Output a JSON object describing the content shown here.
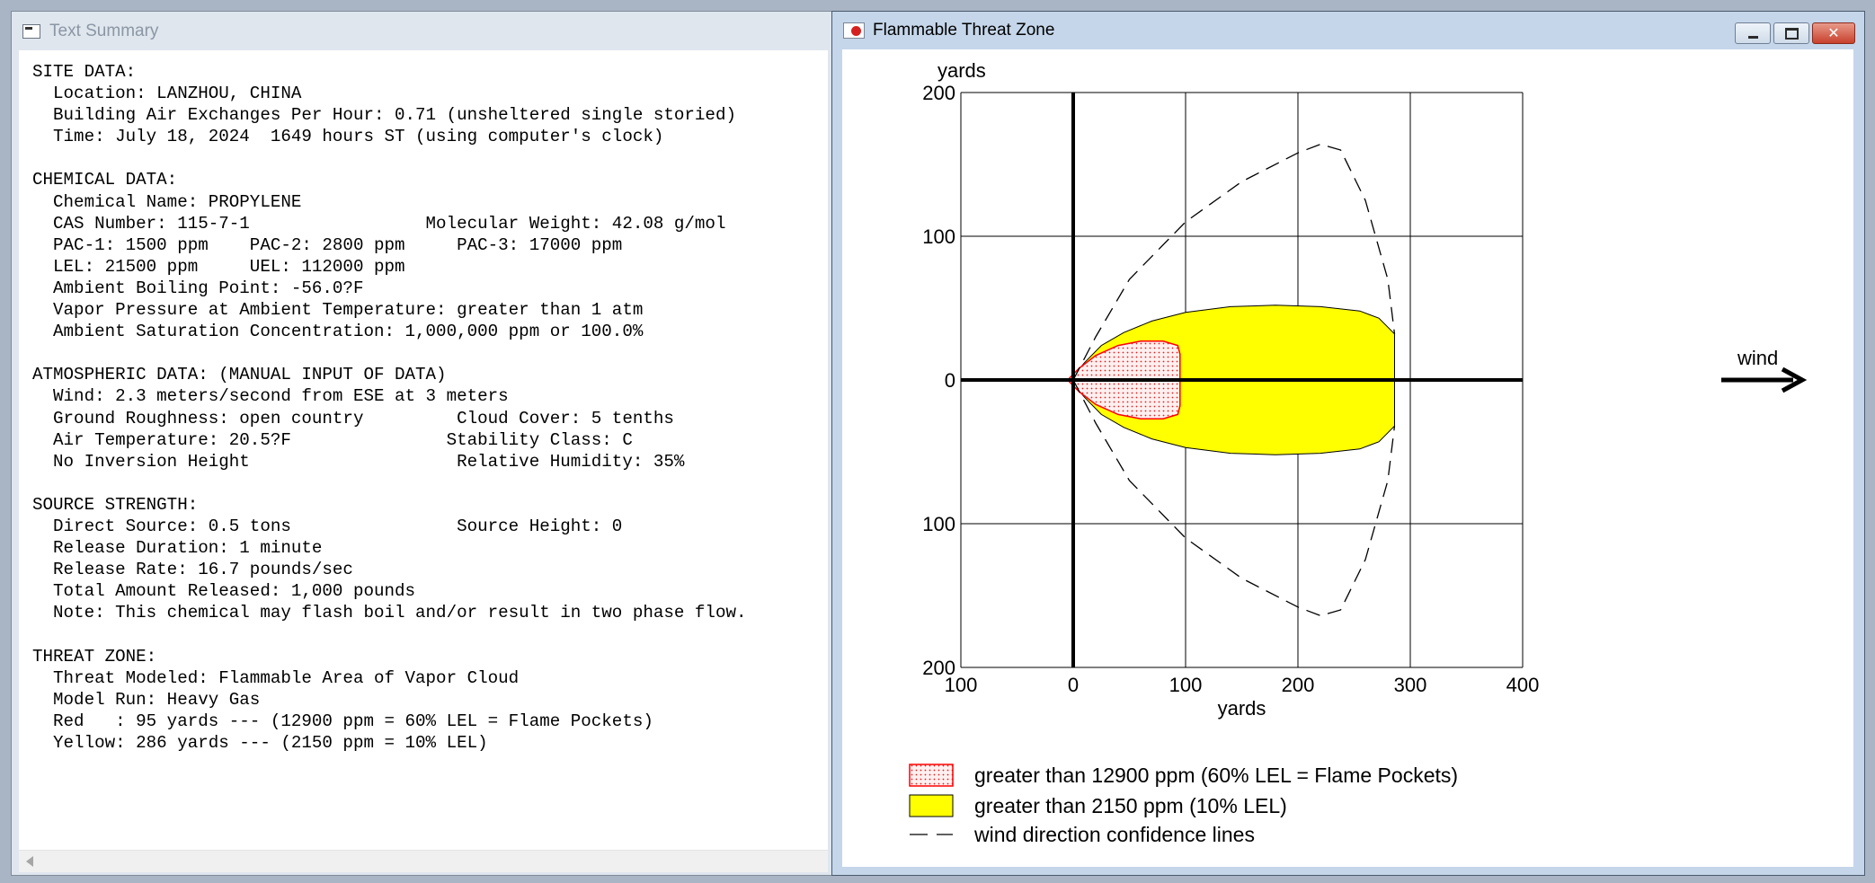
{
  "left_window": {
    "title": "Text Summary",
    "summary_lines": [
      "SITE DATA:",
      "  Location: LANZHOU, CHINA",
      "  Building Air Exchanges Per Hour: 0.71 (unsheltered single storied)",
      "  Time: July 18, 2024  1649 hours ST (using computer's clock)",
      "",
      "CHEMICAL DATA:",
      "  Chemical Name: PROPYLENE",
      "  CAS Number: 115-7-1                 Molecular Weight: 42.08 g/mol",
      "  PAC-1: 1500 ppm    PAC-2: 2800 ppm     PAC-3: 17000 ppm",
      "  LEL: 21500 ppm     UEL: 112000 ppm",
      "  Ambient Boiling Point: -56.0?F",
      "  Vapor Pressure at Ambient Temperature: greater than 1 atm",
      "  Ambient Saturation Concentration: 1,000,000 ppm or 100.0%",
      "",
      "ATMOSPHERIC DATA: (MANUAL INPUT OF DATA)",
      "  Wind: 2.3 meters/second from ESE at 3 meters",
      "  Ground Roughness: open country         Cloud Cover: 5 tenths",
      "  Air Temperature: 20.5?F               Stability Class: C",
      "  No Inversion Height                    Relative Humidity: 35%",
      "",
      "SOURCE STRENGTH:",
      "  Direct Source: 0.5 tons                Source Height: 0",
      "  Release Duration: 1 minute",
      "  Release Rate: 16.7 pounds/sec",
      "  Total Amount Released: 1,000 pounds",
      "  Note: This chemical may flash boil and/or result in two phase flow.",
      "",
      "THREAT ZONE:",
      "  Threat Modeled: Flammable Area of Vapor Cloud",
      "  Model Run: Heavy Gas",
      "  Red   : 95 yards --- (12900 ppm = 60% LEL = Flame Pockets)",
      "  Yellow: 286 yards --- (2150 ppm = 10% LEL)"
    ]
  },
  "right_window": {
    "title": "Flammable Threat Zone",
    "buttons": {
      "minimize": "minimize",
      "maximize": "maximize",
      "close": "close"
    }
  },
  "chart_data": {
    "type": "threat-zone-plot",
    "xlabel": "yards",
    "ylabel": "yards",
    "xlim": [
      -100,
      400
    ],
    "ylim": [
      -200,
      200
    ],
    "x_ticks": [
      -100,
      0,
      100,
      200,
      300,
      400
    ],
    "x_tick_labels": [
      "100",
      "0",
      "100",
      "200",
      "300",
      "400"
    ],
    "y_ticks": [
      200,
      100,
      0,
      -100,
      -200
    ],
    "y_tick_labels": [
      "200",
      "100",
      "0",
      "100",
      "200"
    ],
    "grid": true,
    "wind_label": "wind",
    "colors": {
      "red_zone": "#ff0000",
      "red_fill": "#fff0f0",
      "yellow_zone": "#ffff00",
      "outline": "#000000"
    },
    "zones": [
      {
        "name": "Red",
        "legend": "greater than 12900 ppm (60% LEL = Flame Pockets)",
        "max_downwind_yards": 95,
        "outline": [
          [
            -5,
            0
          ],
          [
            5,
            8
          ],
          [
            20,
            17
          ],
          [
            40,
            24
          ],
          [
            60,
            27
          ],
          [
            80,
            27
          ],
          [
            93,
            24
          ],
          [
            95,
            18
          ],
          [
            95,
            -18
          ],
          [
            93,
            -24
          ],
          [
            80,
            -27
          ],
          [
            60,
            -27
          ],
          [
            40,
            -24
          ],
          [
            20,
            -17
          ],
          [
            5,
            -8
          ]
        ]
      },
      {
        "name": "Yellow",
        "legend": "greater than 2150 ppm (10% LEL)",
        "max_downwind_yards": 286,
        "outline": [
          [
            -3,
            0
          ],
          [
            10,
            12
          ],
          [
            25,
            24
          ],
          [
            45,
            33
          ],
          [
            70,
            41
          ],
          [
            100,
            47
          ],
          [
            140,
            51
          ],
          [
            180,
            52
          ],
          [
            220,
            51
          ],
          [
            255,
            48
          ],
          [
            272,
            43
          ],
          [
            286,
            32
          ],
          [
            286,
            -32
          ],
          [
            272,
            -43
          ],
          [
            255,
            -48
          ],
          [
            220,
            -51
          ],
          [
            180,
            -52
          ],
          [
            140,
            -51
          ],
          [
            100,
            -47
          ],
          [
            70,
            -41
          ],
          [
            45,
            -33
          ],
          [
            25,
            -24
          ],
          [
            10,
            -12
          ]
        ]
      }
    ],
    "confidence_lines": {
      "legend": "wind direction confidence lines",
      "upper": [
        [
          0,
          0
        ],
        [
          20,
          30
        ],
        [
          50,
          70
        ],
        [
          100,
          110
        ],
        [
          150,
          138
        ],
        [
          200,
          158
        ],
        [
          220,
          164
        ],
        [
          238,
          160
        ],
        [
          260,
          125
        ],
        [
          280,
          70
        ],
        [
          286,
          32
        ]
      ],
      "lower": [
        [
          0,
          0
        ],
        [
          20,
          -30
        ],
        [
          50,
          -70
        ],
        [
          100,
          -110
        ],
        [
          150,
          -138
        ],
        [
          200,
          -158
        ],
        [
          220,
          -164
        ],
        [
          238,
          -160
        ],
        [
          260,
          -125
        ],
        [
          280,
          -70
        ],
        [
          286,
          -32
        ]
      ]
    }
  }
}
